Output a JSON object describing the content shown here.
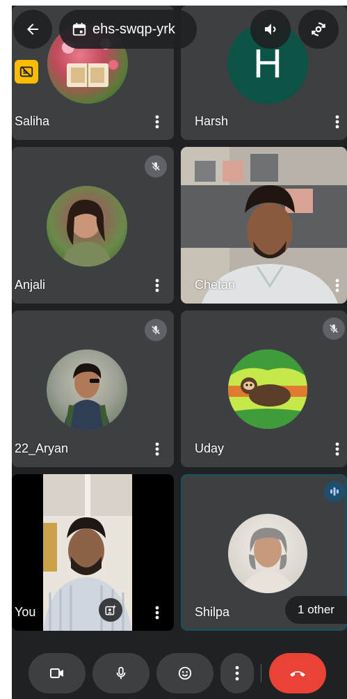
{
  "meeting": {
    "code": "ehs-swqp-yrk"
  },
  "participants": [
    {
      "name": "Saliha"
    },
    {
      "name": "Harsh",
      "initial": "H"
    },
    {
      "name": "Anjali"
    },
    {
      "name": "Chetan"
    },
    {
      "name": "22_Aryan"
    },
    {
      "name": "Uday"
    },
    {
      "name": "You"
    },
    {
      "name": "Shilpa"
    }
  ],
  "others_chip": "1 other",
  "colors": {
    "background": "#202124",
    "tile": "#3c4043",
    "active_border": "#1f4e57",
    "end_call": "#ea4335",
    "harsh_avatar": "#0b5345"
  },
  "icons": {
    "back": "arrow-left-icon",
    "calendar": "calendar-icon",
    "speaker": "speaker-icon",
    "switch_camera": "switch-camera-icon",
    "camera": "video-camera-icon",
    "mic": "microphone-icon",
    "emoji": "emoji-icon",
    "more": "more-vert-icon",
    "end": "call-end-icon"
  }
}
